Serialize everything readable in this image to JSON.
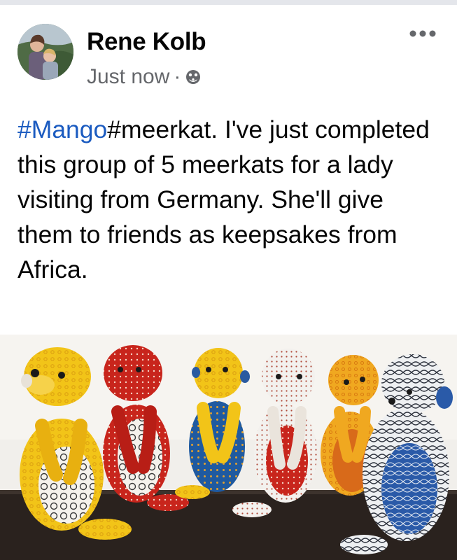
{
  "post": {
    "author_name": "Rene Kolb",
    "timestamp": "Just now",
    "separator": "·",
    "audience_icon": "public-globe-icon",
    "more_icon": "more-options-icon",
    "hashtags": [
      "#Mango",
      "#meerkat"
    ],
    "body_rest": ". I've just completed this group of 5 meerkats for a lady visiting from Germany. She'll give them to friends as keepsakes from Africa."
  },
  "colors": {
    "hashtag": "#1b5bc0",
    "author": "#050505",
    "meta": "#65676b",
    "top_strip": "#e4e6eb"
  }
}
